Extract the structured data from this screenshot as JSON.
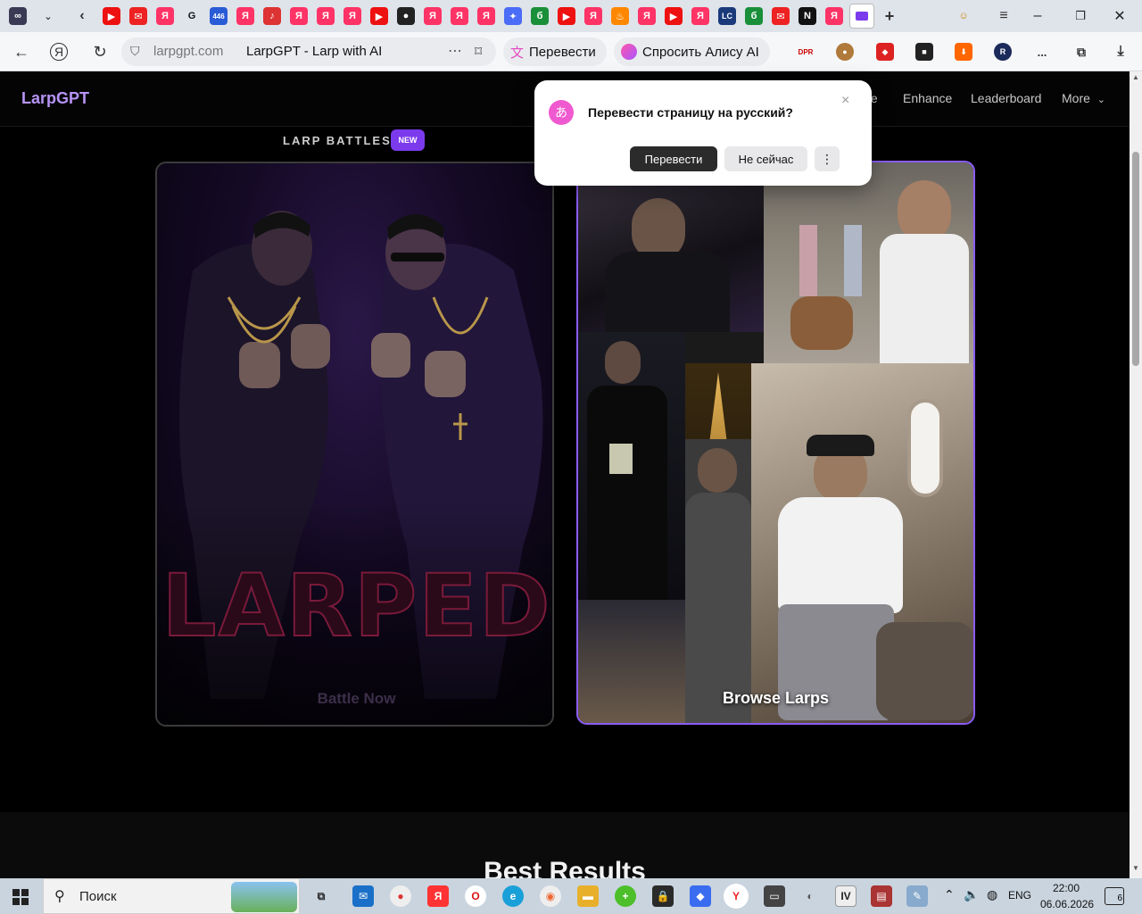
{
  "browser": {
    "url_host": "larpgpt.com",
    "page_title": "LarpGPT - Larp with AI",
    "translate_label": "Перевести",
    "alice_label": "Спросить Алису AI",
    "more_dots": "...",
    "tab_count_badge": "446"
  },
  "site": {
    "brand": "LarpGPT",
    "nav": {
      "partial_item": "te",
      "enhance": "Enhance",
      "leaderboard": "Leaderboard",
      "more": "More"
    },
    "battles": {
      "section_title": "LARP BATTLES",
      "badge": "NEW",
      "big_word": "LARPED",
      "cta": "Battle Now"
    },
    "browse": {
      "label": "Browse Larps"
    },
    "results_title": "Best Results"
  },
  "translate_popup": {
    "icon": "あ",
    "question": "Перевести страницу на русский?",
    "translate_button": "Перевести",
    "later_button": "Не сейчас",
    "more_button": "⋮",
    "close": "×"
  },
  "taskbar": {
    "search_placeholder": "Поиск",
    "language": "ENG",
    "time": "22:00",
    "date": "06.06.2026",
    "notifications": "6"
  }
}
